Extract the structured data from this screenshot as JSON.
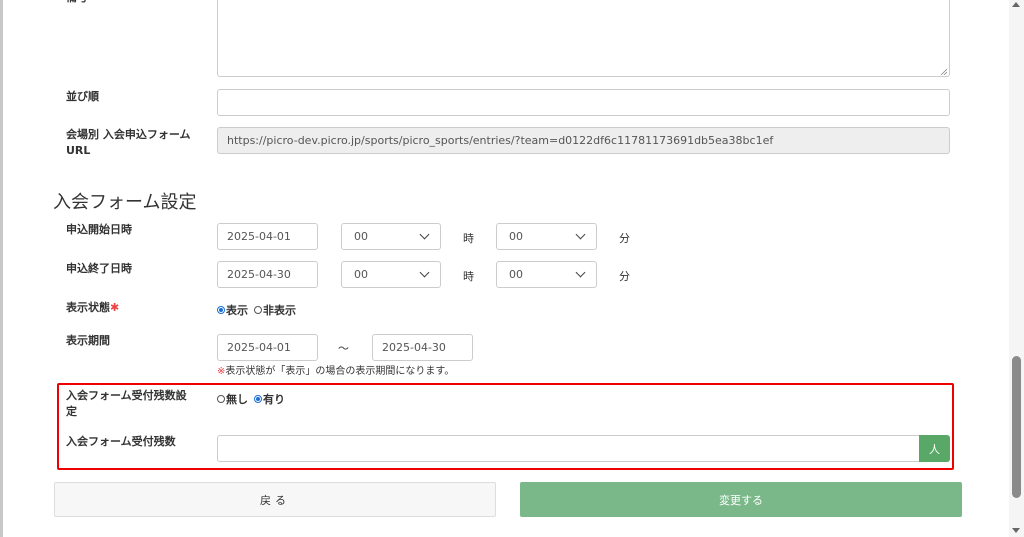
{
  "top_label_partial": "備考",
  "sort": {
    "label": "並び順",
    "value": ""
  },
  "venue_url": {
    "label_line1": "会場別 入会申込フォーム",
    "label_line2": "URL",
    "value": "https://picro-dev.picro.jp/sports/picro_sports/entries/?team=d0122df6c11781173691db5ea38bc1ef"
  },
  "section_title": "入会フォーム設定",
  "apply_start": {
    "label": "申込開始日時",
    "date": "2025-04-01",
    "hour": "00",
    "hour_unit": "時",
    "minute": "00",
    "minute_unit": "分"
  },
  "apply_end": {
    "label": "申込終了日時",
    "date": "2025-04-30",
    "hour": "00",
    "hour_unit": "時",
    "minute": "00",
    "minute_unit": "分"
  },
  "display_status": {
    "label": "表示状態",
    "required_mark": "✱",
    "options": [
      "表示",
      "非表示"
    ],
    "selected": "表示"
  },
  "display_period": {
    "label": "表示期間",
    "start": "2025-04-01",
    "separator": "〜",
    "end": "2025-04-30",
    "note_mark": "※",
    "note": "表示状態が「表示」の場合の表示期間になります。"
  },
  "remaining_setting": {
    "label_line1": "入会フォーム受付残数設",
    "label_line2": "定",
    "options": [
      "無し",
      "有り"
    ],
    "selected": "有り"
  },
  "remaining_count": {
    "label": "入会フォーム受付残数",
    "value": "",
    "unit": "人"
  },
  "buttons": {
    "back": "戻る",
    "submit": "変更する"
  },
  "colors": {
    "highlight": "#e00000",
    "submit": "#7ab88a",
    "addon": "#5aa868",
    "radio": "#1a6fd6"
  }
}
